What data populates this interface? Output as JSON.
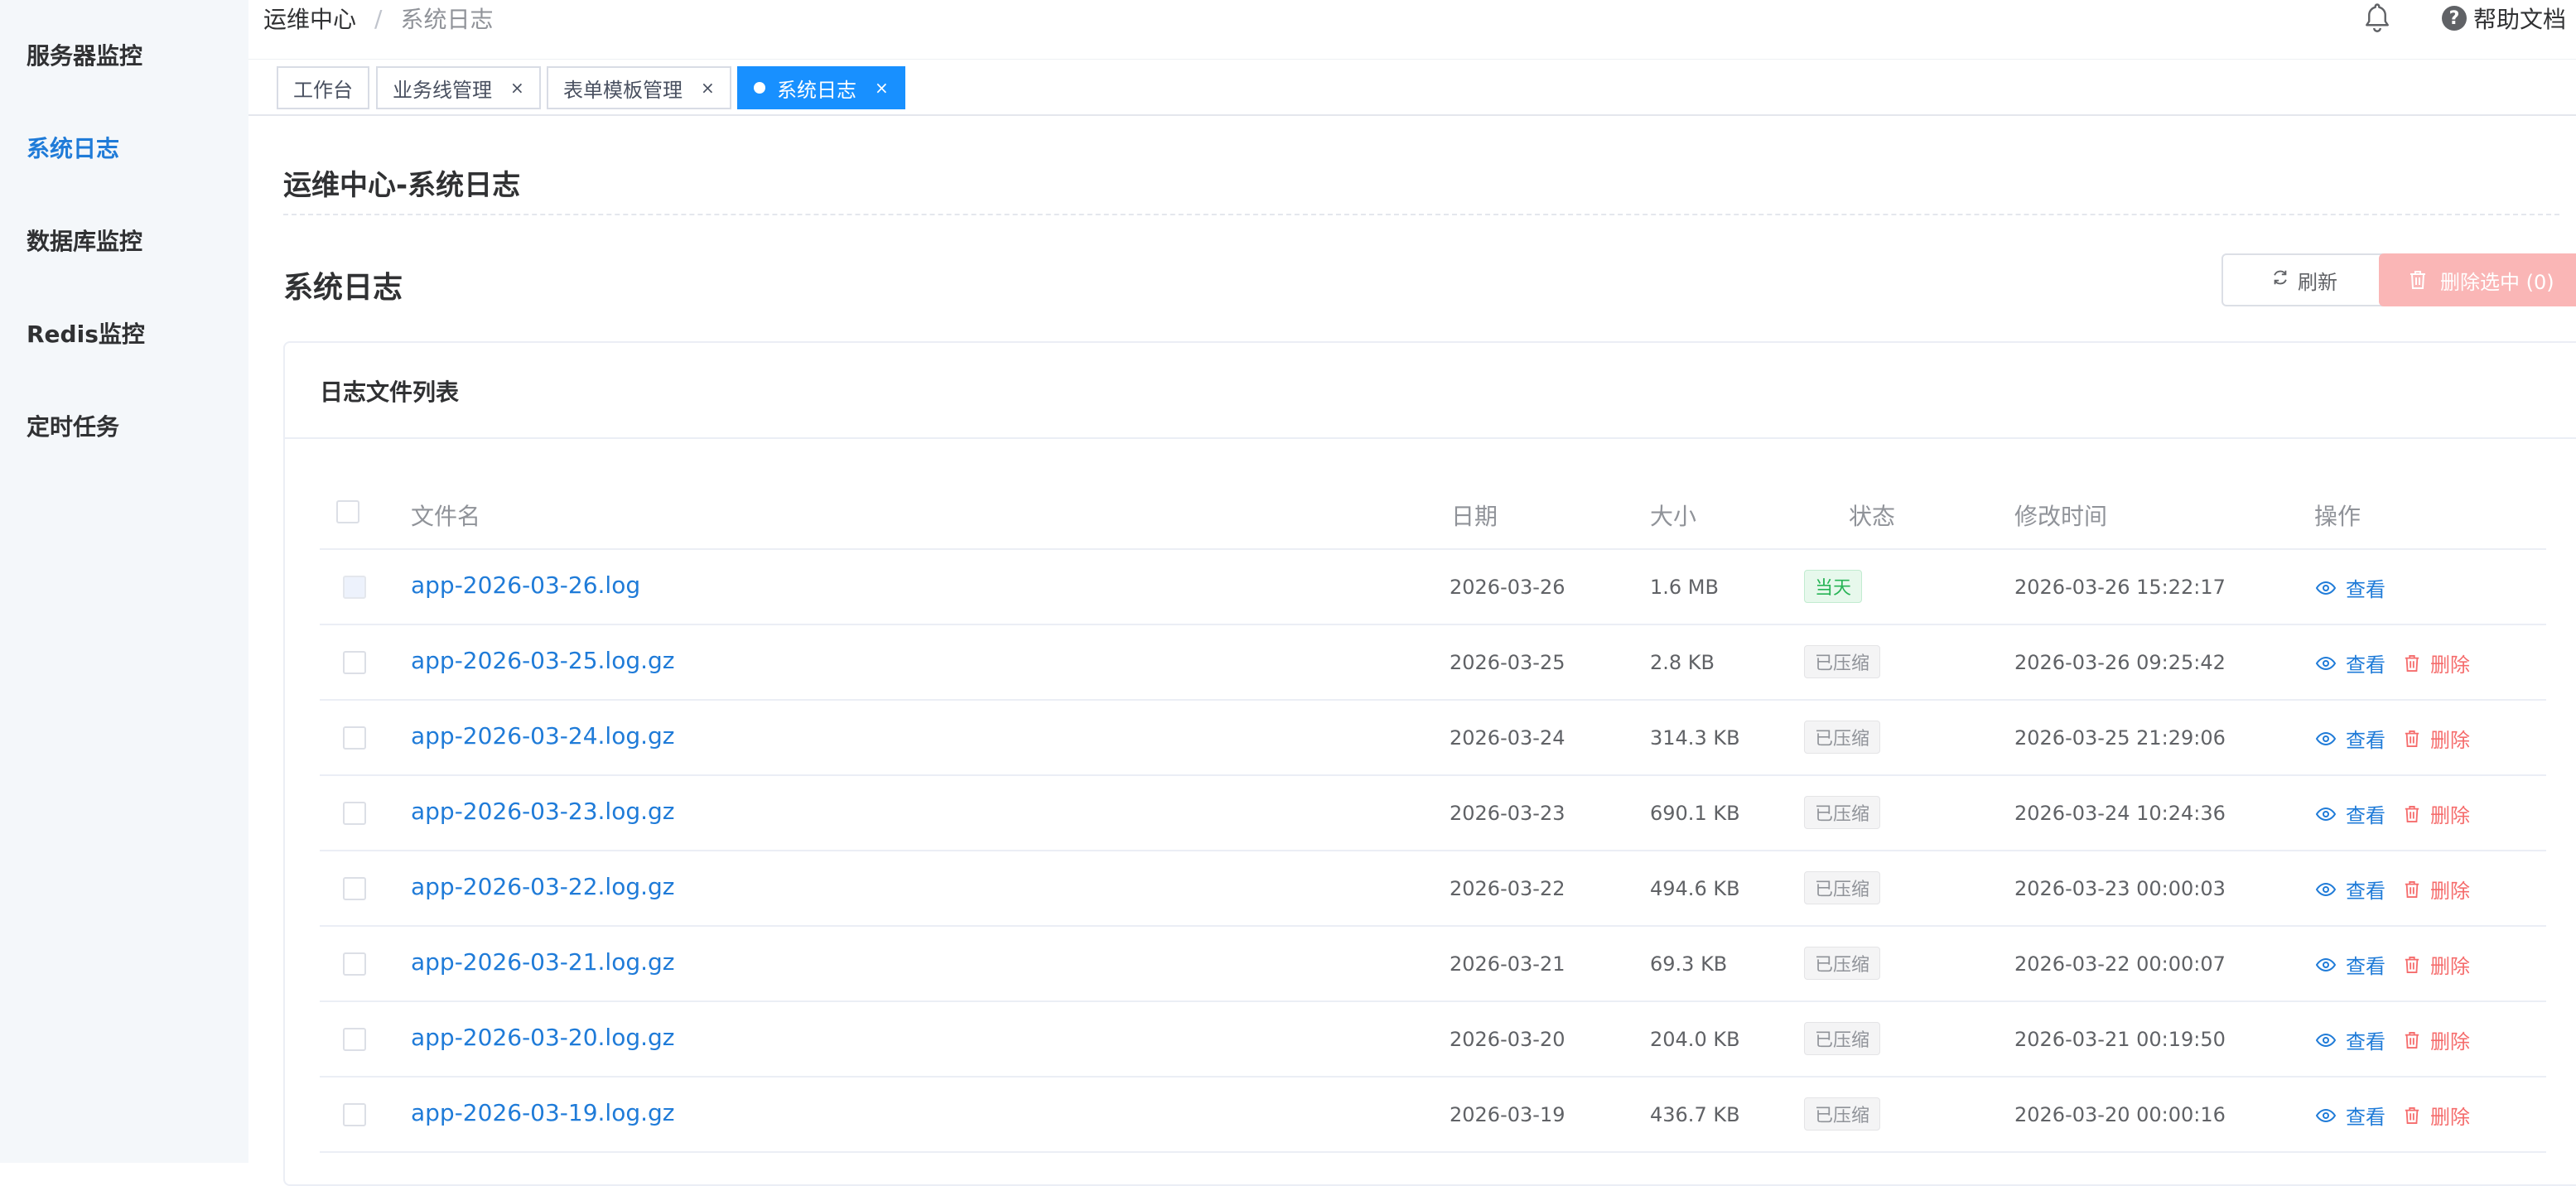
{
  "sidebar": {
    "items": [
      {
        "label": "服务器监控",
        "active": false
      },
      {
        "label": "系统日志",
        "active": true
      },
      {
        "label": "数据库监控",
        "active": false
      },
      {
        "label": "Redis监控",
        "active": false
      },
      {
        "label": "定时任务",
        "active": false
      }
    ]
  },
  "header": {
    "breadcrumb": {
      "root": "运维中心",
      "separator": "/",
      "current": "系统日志"
    },
    "help_label": "帮助文档"
  },
  "tags": [
    {
      "label": "工作台",
      "closable": false,
      "active": false
    },
    {
      "label": "业务线管理",
      "closable": true,
      "active": false
    },
    {
      "label": "表单模板管理",
      "closable": true,
      "active": false
    },
    {
      "label": "系统日志",
      "closable": true,
      "active": true
    }
  ],
  "tag_close_glyph": "×",
  "page": {
    "title": "运维中心-系统日志",
    "section_title": "系统日志",
    "refresh_label": "刷新",
    "delete_selected_label": "删除选中 (0)"
  },
  "card": {
    "title": "日志文件列表",
    "columns": {
      "name": "文件名",
      "date": "日期",
      "size": "大小",
      "status": "状态",
      "modified": "修改时间",
      "actions": "操作"
    },
    "view_label": "查看",
    "delete_label": "删除",
    "rows": [
      {
        "name": "app-2026-03-26.log",
        "date": "2026-03-26",
        "size": "1.6 MB",
        "status": "当天",
        "status_type": "today",
        "modified": "2026-03-26 15:22:17",
        "deletable": false
      },
      {
        "name": "app-2026-03-25.log.gz",
        "date": "2026-03-25",
        "size": "2.8 KB",
        "status": "已压缩",
        "status_type": "compressed",
        "modified": "2026-03-26 09:25:42",
        "deletable": true
      },
      {
        "name": "app-2026-03-24.log.gz",
        "date": "2026-03-24",
        "size": "314.3 KB",
        "status": "已压缩",
        "status_type": "compressed",
        "modified": "2026-03-25 21:29:06",
        "deletable": true
      },
      {
        "name": "app-2026-03-23.log.gz",
        "date": "2026-03-23",
        "size": "690.1 KB",
        "status": "已压缩",
        "status_type": "compressed",
        "modified": "2026-03-24 10:24:36",
        "deletable": true
      },
      {
        "name": "app-2026-03-22.log.gz",
        "date": "2026-03-22",
        "size": "494.6 KB",
        "status": "已压缩",
        "status_type": "compressed",
        "modified": "2026-03-23 00:00:03",
        "deletable": true
      },
      {
        "name": "app-2026-03-21.log.gz",
        "date": "2026-03-21",
        "size": "69.3 KB",
        "status": "已压缩",
        "status_type": "compressed",
        "modified": "2026-03-22 00:00:07",
        "deletable": true
      },
      {
        "name": "app-2026-03-20.log.gz",
        "date": "2026-03-20",
        "size": "204.0 KB",
        "status": "已压缩",
        "status_type": "compressed",
        "modified": "2026-03-21 00:19:50",
        "deletable": true
      },
      {
        "name": "app-2026-03-19.log.gz",
        "date": "2026-03-19",
        "size": "436.7 KB",
        "status": "已压缩",
        "status_type": "compressed",
        "modified": "2026-03-20 00:00:16",
        "deletable": true
      }
    ]
  },
  "colors": {
    "primary": "#1890ff",
    "link": "#1f7bd8",
    "danger": "#f56c6c",
    "success": "#28b456"
  }
}
